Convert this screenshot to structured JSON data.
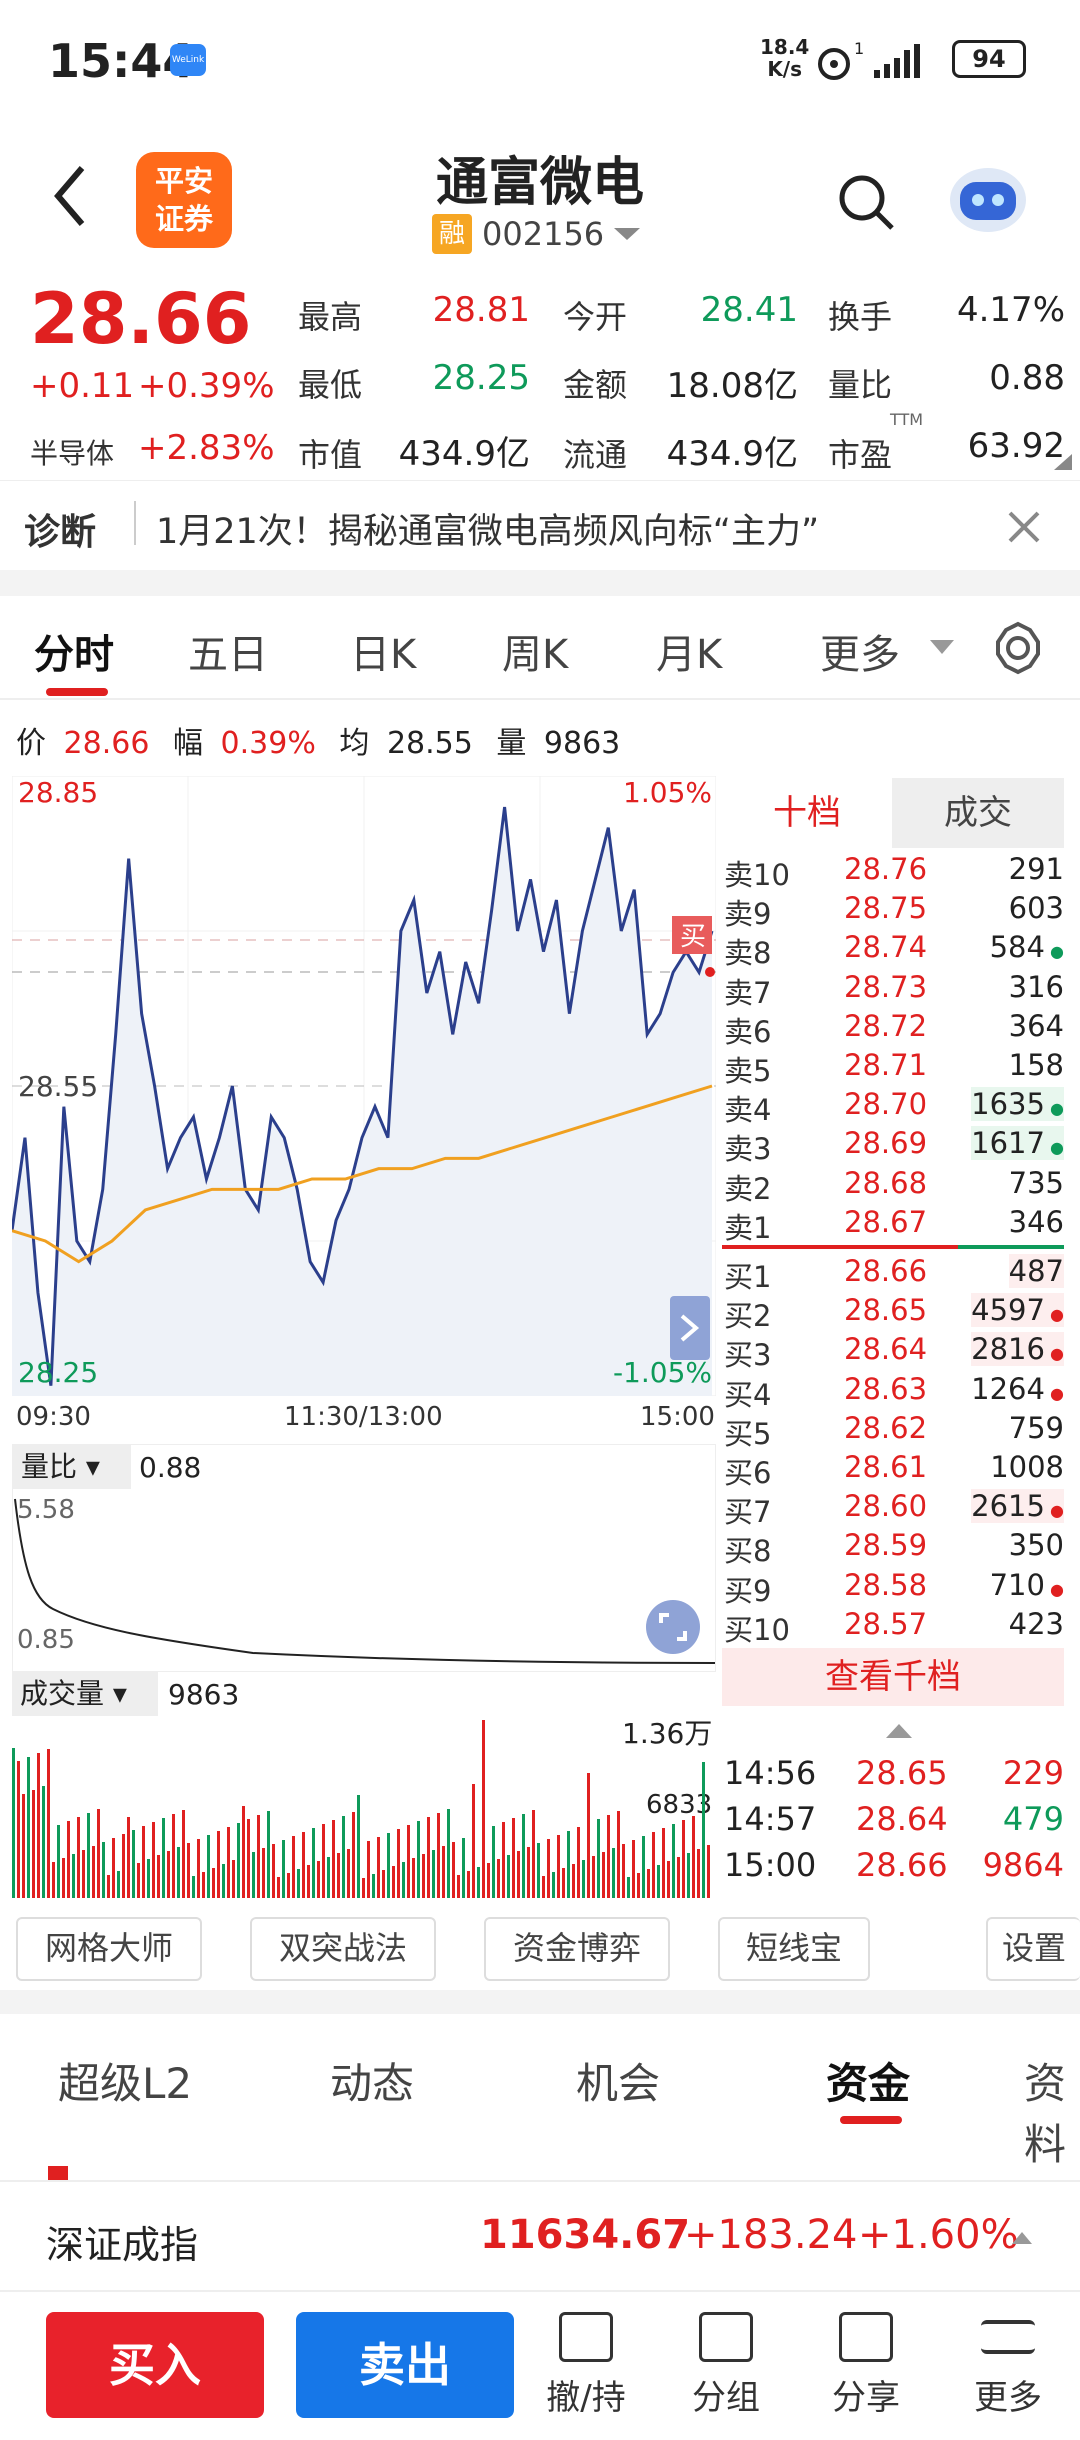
{
  "status_bar": {
    "time": "15:44",
    "app_badge": "WeLink",
    "net_speed": "18.4",
    "net_unit": "K/s",
    "signal": "1",
    "battery": "94"
  },
  "header": {
    "back_icon": "chevron-left-icon",
    "logo_line1": "平安",
    "logo_line2": "证券",
    "name": "通富微电",
    "margin_badge": "融",
    "code": "002156",
    "search_icon": "search-icon",
    "assistant_icon": "robot-icon"
  },
  "quote": {
    "price": "28.66",
    "change": "+0.11",
    "change_pct": "+0.39%",
    "sector": "半导体",
    "sector_pct": "+2.83%",
    "high_label": "最高",
    "high": "28.81",
    "open_label": "今开",
    "open": "28.41",
    "turnover_label": "换手",
    "turnover": "4.17%",
    "low_label": "最低",
    "low": "28.25",
    "amount_label": "金额",
    "amount": "18.08亿",
    "volratio_label": "量比",
    "volratio": "0.88",
    "mcap_label": "市值",
    "mcap": "434.9亿",
    "float_label": "流通",
    "float": "434.9亿",
    "pe_label": "市盈",
    "pe_sup": "TTM",
    "pe": "63.92"
  },
  "diagnosis": {
    "label": "诊断",
    "text": "1月21次！揭秘通富微电高频风向标“主力”"
  },
  "chart_tabs": [
    "分时",
    "五日",
    "日K",
    "周K",
    "月K",
    "更多"
  ],
  "chart_info": {
    "price_label": "价",
    "price": "28.66",
    "amp_label": "幅",
    "amp": "0.39%",
    "avg_label": "均",
    "avg": "28.55",
    "vol_label": "量",
    "vol": "9863"
  },
  "chart_labels": {
    "top": "28.85",
    "mid": "28.55",
    "bottom": "28.25",
    "top_pct": "1.05%",
    "bottom_pct": "-1.05%",
    "t_start": "09:30",
    "t_mid": "11:30/13:00",
    "t_end": "15:00",
    "buy_marker": "买"
  },
  "volratio_panel": {
    "label": "量比",
    "value": "0.88",
    "max": "5.58",
    "min": "0.85"
  },
  "volume_panel": {
    "label": "成交量",
    "value": "9863",
    "max": "1.36万",
    "mid": "6833"
  },
  "chart_data": {
    "type": "line",
    "x_range": [
      "09:30",
      "15:00"
    ],
    "ylim": [
      28.25,
      28.85
    ],
    "series": [
      {
        "color": "#2b3f8c",
        "values": [
          28.41,
          28.5,
          28.35,
          28.26,
          28.53,
          28.4,
          28.38,
          28.45,
          28.6,
          28.77,
          28.62,
          28.55,
          28.47,
          28.5,
          28.52,
          28.46,
          28.5,
          28.55,
          28.45,
          28.43,
          28.52,
          28.5,
          28.45,
          28.38,
          28.36,
          28.42,
          28.45,
          28.5,
          28.53,
          28.5,
          28.7,
          28.73,
          28.64,
          28.68,
          28.6,
          28.67,
          28.63,
          28.72,
          28.82,
          28.7,
          28.75,
          28.68,
          28.73,
          28.62,
          28.7,
          28.75,
          28.8,
          28.7,
          28.74,
          28.6,
          28.62,
          28.66,
          28.68,
          28.66,
          28.7
        ]
      },
      {
        "color": "#f0a020",
        "values": [
          28.41,
          28.4,
          28.38,
          28.4,
          28.43,
          28.44,
          28.45,
          28.45,
          28.45,
          28.46,
          28.46,
          28.47,
          28.47,
          28.48,
          28.48,
          28.49,
          28.5,
          28.51,
          28.52,
          28.53,
          28.54,
          28.55
        ]
      }
    ]
  },
  "order_book": {
    "tab_active": "十档",
    "tab_other": "成交",
    "asks": [
      [
        "卖10",
        "28.76",
        "291"
      ],
      [
        "卖9",
        "28.75",
        "603"
      ],
      [
        "卖8",
        "28.74",
        "584"
      ],
      [
        "卖7",
        "28.73",
        "316"
      ],
      [
        "卖6",
        "28.72",
        "364"
      ],
      [
        "卖5",
        "28.71",
        "158"
      ],
      [
        "卖4",
        "28.70",
        "1635"
      ],
      [
        "卖3",
        "28.69",
        "1617"
      ],
      [
        "卖2",
        "28.68",
        "735"
      ],
      [
        "卖1",
        "28.67",
        "346"
      ]
    ],
    "bids": [
      [
        "买1",
        "28.66",
        "487"
      ],
      [
        "买2",
        "28.65",
        "4597"
      ],
      [
        "买3",
        "28.64",
        "2816"
      ],
      [
        "买4",
        "28.63",
        "1264"
      ],
      [
        "买5",
        "28.62",
        "759"
      ],
      [
        "买6",
        "28.61",
        "1008"
      ],
      [
        "买7",
        "28.60",
        "2615"
      ],
      [
        "买8",
        "28.59",
        "350"
      ],
      [
        "买9",
        "28.58",
        "710"
      ],
      [
        "买10",
        "28.57",
        "423"
      ]
    ],
    "more": "查看千档",
    "trades": [
      [
        "14:56",
        "28.65",
        "229"
      ],
      [
        "14:57",
        "28.64",
        "479"
      ],
      [
        "15:00",
        "28.66",
        "9864"
      ]
    ]
  },
  "tools": [
    "网格大师",
    "双突战法",
    "资金博弈",
    "短线宝",
    "设置"
  ],
  "bottom_tabs": [
    "超级L2",
    "动态",
    "机会",
    "资金",
    "资料"
  ],
  "index": {
    "name": "深证成指",
    "value": "11634.67",
    "change": "+183.24",
    "pct": "+1.60%"
  },
  "actions": {
    "buy": "买入",
    "sell": "卖出",
    "a1": "撤/持",
    "a2": "分组",
    "a3": "分享",
    "a4": "更多"
  }
}
